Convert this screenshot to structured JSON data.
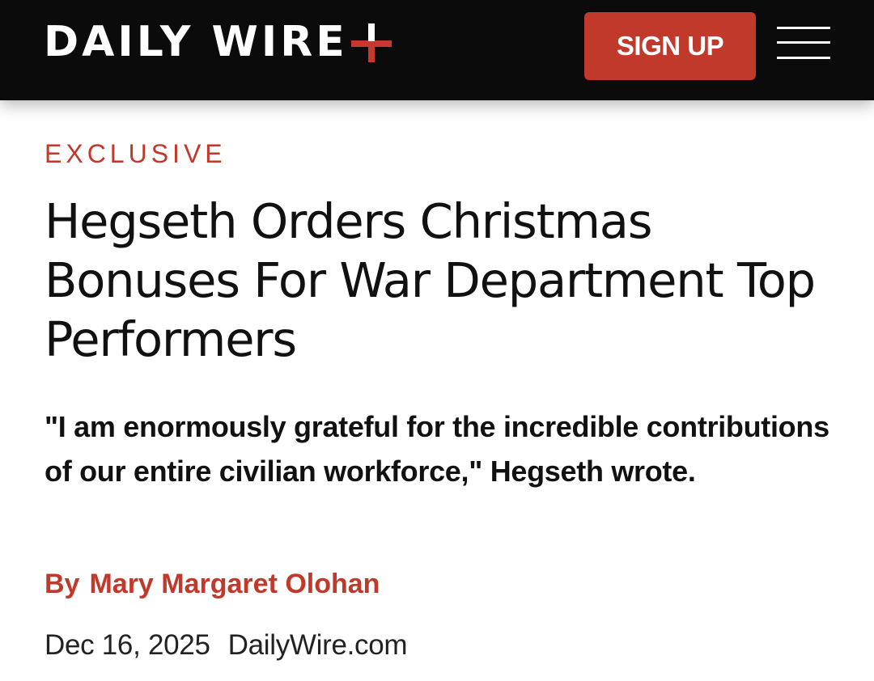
{
  "header": {
    "logo_text": "DAILY WIRE",
    "logo_symbol": "plus-icon",
    "signup_label": "SIGN UP",
    "menu_icon": "hamburger-menu-icon",
    "background_color": "#0b0b0b",
    "accent_color": "#c0392b"
  },
  "article": {
    "kicker": "EXCLUSIVE",
    "headline": "Hegseth Orders Christmas Bonuses For War Department Top Performers",
    "dek": "\"I am enormously grateful for the incredible contributions of our entire civilian workforce,\" Hegseth wrote.",
    "byline_prefix": "By",
    "author": "Mary Margaret Olohan",
    "date": "Dec 16, 2025",
    "source": "DailyWire.com"
  }
}
